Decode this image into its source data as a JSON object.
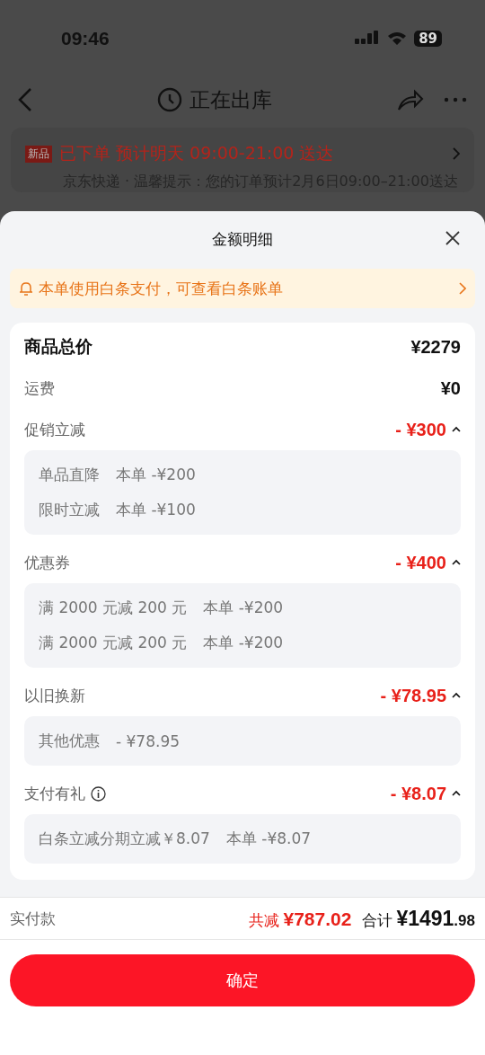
{
  "status_bar": {
    "time": "09:46",
    "battery": "89"
  },
  "nav": {
    "title": "正在出库"
  },
  "order": {
    "badge": "新品",
    "headline": "已下单 预计明天 09:00-21:00 送达",
    "sub": "京东快递 · 温馨提示：您的订单预计2月6日09:00–21:00送达"
  },
  "sheet": {
    "title": "金额明细",
    "notice": "本单使用白条支付，可查看白条账单",
    "rows": [
      {
        "kind": "total",
        "label": "商品总价",
        "amount": "¥2279"
      },
      {
        "kind": "plain",
        "label": "运费",
        "amount": "¥0"
      }
    ],
    "groups": [
      {
        "label": "促销立减",
        "amount": "- ¥300",
        "expanded": true,
        "info": false,
        "details": [
          {
            "name": "单品直降",
            "note": "本单 -¥200"
          },
          {
            "name": "限时立减",
            "note": "本单 -¥100"
          }
        ]
      },
      {
        "label": "优惠券",
        "amount": "- ¥400",
        "expanded": true,
        "info": false,
        "details": [
          {
            "name": "满 2000 元减 200 元",
            "note": "本单 -¥200"
          },
          {
            "name": "满 2000 元减 200 元",
            "note": "本单 -¥200"
          }
        ]
      },
      {
        "label": "以旧换新",
        "amount": "- ¥78.95",
        "expanded": true,
        "info": false,
        "details": [
          {
            "name": "其他优惠",
            "note": "- ¥78.95"
          }
        ]
      },
      {
        "label": "支付有礼",
        "amount": "- ¥8.07",
        "expanded": true,
        "info": true,
        "details": [
          {
            "name": "白条立减分期立减￥8.07",
            "note": "本单 -¥8.07"
          }
        ]
      }
    ],
    "footer": {
      "label": "实付款",
      "saved_label": "共减",
      "saved": "¥787.02",
      "total_label": "合计",
      "total_int": "¥1491",
      "total_dec": ".98"
    },
    "confirm": "确定"
  }
}
